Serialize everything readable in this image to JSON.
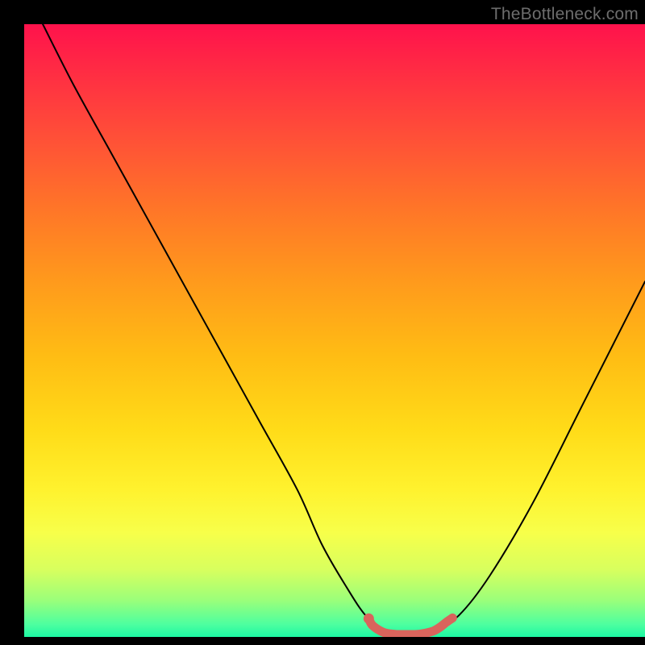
{
  "watermark": "TheBottleneck.com",
  "chart_data": {
    "type": "line",
    "title": "",
    "xlabel": "",
    "ylabel": "",
    "xlim": [
      0,
      100
    ],
    "ylim": [
      0,
      100
    ],
    "series": [
      {
        "name": "bottleneck-curve",
        "x": [
          3,
          8,
          14,
          20,
          26,
          32,
          38,
          44,
          48,
          52,
          55,
          58,
          60,
          63,
          66,
          70,
          75,
          82,
          90,
          100
        ],
        "y": [
          100,
          90,
          79,
          68,
          57,
          46,
          35,
          24,
          15,
          8,
          3.5,
          1,
          0.4,
          0.4,
          1,
          3.5,
          10,
          22,
          38,
          58
        ]
      },
      {
        "name": "bottom-highlight-left",
        "x": [
          55.5,
          56,
          57,
          58,
          59,
          60
        ],
        "y": [
          3.0,
          2.0,
          1.2,
          0.7,
          0.5,
          0.4
        ]
      },
      {
        "name": "bottom-highlight-right",
        "x": [
          60,
          61,
          62,
          63,
          64,
          65,
          66,
          67,
          68,
          69
        ],
        "y": [
          0.4,
          0.4,
          0.4,
          0.4,
          0.5,
          0.7,
          1.0,
          1.6,
          2.4,
          3.1
        ]
      }
    ],
    "highlight_color": "#d9645c",
    "curve_color": "#000000"
  }
}
